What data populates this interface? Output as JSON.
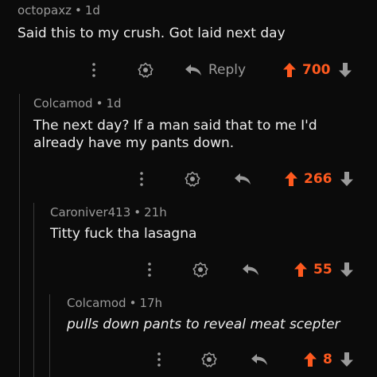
{
  "theme": {
    "upvote_color": "#ff5a1f",
    "muted": "#9a9a9a",
    "background": "#0b0b0b"
  },
  "comments": [
    {
      "author": "octopaxz",
      "age": "1d",
      "text": "Said this to my crush. Got laid next day",
      "reply_label": "Reply",
      "score": "700"
    },
    {
      "author": "Colcamod",
      "age": "1d",
      "text": "The next day? If a man said that to me I'd already have my pants down.",
      "score": "266"
    },
    {
      "author": "Caroniver413",
      "age": "21h",
      "text": "Titty fuck tha lasagna",
      "score": "55"
    },
    {
      "author": "Colcamod",
      "age": "17h",
      "text": "pulls down pants to reveal meat scepter",
      "score": "8"
    }
  ],
  "icons": {
    "more": "more-vertical-icon",
    "award": "award-icon",
    "reply": "reply-arrow-icon",
    "upvote": "upvote-arrow-icon",
    "downvote": "downvote-arrow-icon"
  }
}
